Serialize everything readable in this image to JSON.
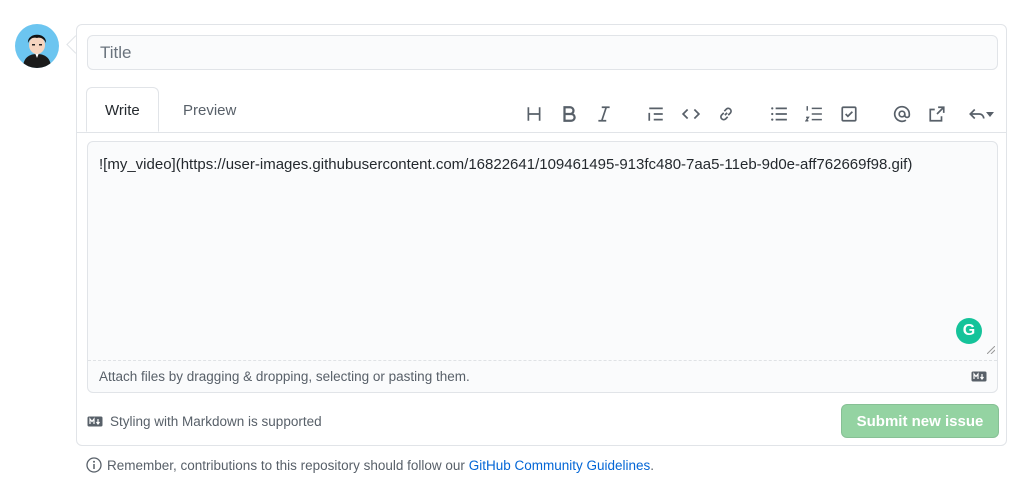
{
  "form": {
    "title_placeholder": "Title",
    "tabs": [
      {
        "label": "Write"
      },
      {
        "label": "Preview"
      }
    ],
    "toolbar": [
      "header-icon",
      "bold-icon",
      "italic-icon",
      "quote-icon",
      "code-icon",
      "link-icon",
      "bulleted-list-icon",
      "numbered-list-icon",
      "task-list-icon",
      "mention-icon",
      "cross-reference-icon",
      "reply-icon"
    ],
    "body_value": "![my_video](https://user-images.githubusercontent.com/16822641/109461495-913fc480-7aa5-11eb-9d0e-aff762669f98.gif)",
    "attach_text": "Attach files by dragging & dropping, selecting or pasting them.",
    "grammarly_label": "G",
    "markdown_note": "Styling with Markdown is supported",
    "submit_label": "Submit new issue"
  },
  "guidelines": {
    "prefix": "Remember, contributions to this repository should follow our ",
    "link": "GitHub Community Guidelines",
    "suffix": "."
  },
  "colors": {
    "submit_disabled": "#94d3a2",
    "link": "#0366d6",
    "grammarly": "#15c39a",
    "avatar_bg": "#6cc5f0"
  }
}
